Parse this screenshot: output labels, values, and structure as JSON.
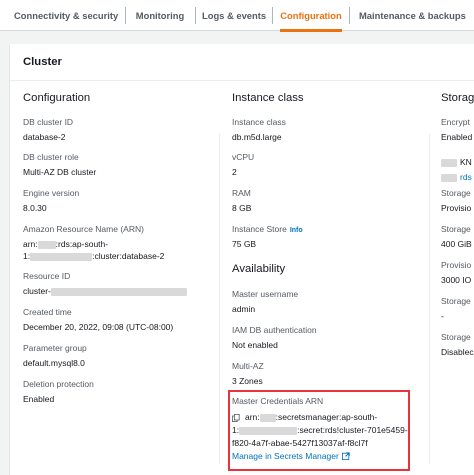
{
  "tabs": [
    {
      "label": "Connectivity & security"
    },
    {
      "label": "Monitoring"
    },
    {
      "label": "Logs & events"
    },
    {
      "label": "Configuration"
    },
    {
      "label": "Maintenance & backups"
    }
  ],
  "active_tab": "Configuration",
  "card": {
    "title": "Cluster"
  },
  "configuration": {
    "title": "Configuration",
    "fields": [
      {
        "label": "DB cluster ID",
        "value": "database-2"
      },
      {
        "label": "DB cluster role",
        "value": "Multi-AZ DB cluster"
      },
      {
        "label": "Engine version",
        "value": "8.0.30"
      },
      {
        "label": "Amazon Resource Name (ARN)",
        "value_line1_prefix": "arn:",
        "value_line1_suffix": ":rds:ap-south-",
        "value_line2_prefix": "1:",
        "value_line2_suffix": ":cluster:database-2"
      },
      {
        "label": "Resource ID",
        "value": "cluster-"
      },
      {
        "label": "Created time",
        "value": "December 20, 2022, 09:08 (UTC-08:00)"
      },
      {
        "label": "Parameter group",
        "value": "default.mysql8.0"
      },
      {
        "label": "Deletion protection",
        "value": "Enabled"
      }
    ]
  },
  "instance_class": {
    "title": "Instance class",
    "fields": [
      {
        "label": "Instance class",
        "value": "db.m5d.large"
      },
      {
        "label": "vCPU",
        "value": "2"
      },
      {
        "label": "RAM",
        "value": "8 GB"
      },
      {
        "label": "Instance Store",
        "info": "Info",
        "value": "75 GB"
      }
    ]
  },
  "availability": {
    "title": "Availability",
    "fields": [
      {
        "label": "Master username",
        "value": "admin"
      },
      {
        "label": "IAM DB authentication",
        "value": "Not enabled"
      },
      {
        "label": "Multi-AZ",
        "value": "3 Zones"
      }
    ],
    "master_credentials": {
      "label": "Master Credentials ARN",
      "line1_prefix": "arn:",
      "line1_suffix": ":secretsmanager:ap-south-",
      "line2_prefix": "1:",
      "line2_suffix": ":secret:rds!cluster-701e5459-",
      "line3": "f820-4a7f-abae-5427f13037af-f8cl7f",
      "link": "Manage in Secrets Manager"
    }
  },
  "storage": {
    "title": "Storag",
    "rows": [
      {
        "label": "Encrypt",
        "value": "Enabled"
      },
      {
        "label": "",
        "value": "KN"
      },
      {
        "label": "",
        "value": "rds"
      },
      {
        "label": "Storage",
        "value": "Provisio"
      },
      {
        "label": "Storage",
        "value": "400 GiB"
      },
      {
        "label": "Provisio",
        "value": "3000 IO"
      },
      {
        "label": "Storage",
        "value": "-"
      },
      {
        "label": "Storage",
        "value": "Disablec"
      }
    ]
  },
  "colors": {
    "accent": "#ec7211",
    "link": "#0073bb",
    "highlight": "#e8333a"
  }
}
